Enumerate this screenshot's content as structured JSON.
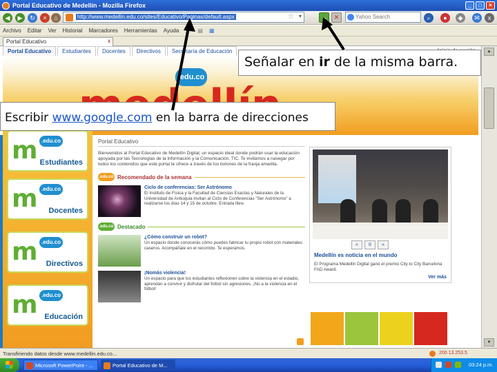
{
  "window": {
    "title": "Portal Educativo de Medellín - Mozilla Firefox",
    "buttons": [
      "_",
      "□",
      "×"
    ]
  },
  "navbar": {
    "back_label": "◀",
    "forward_label": "▶",
    "reload_label": "↻",
    "home_label": "⌂",
    "url": "http://www.medellin.edu.co/sites/Educativo/Paginas/default.aspx",
    "star_label": "☆",
    "url_drop_label": "▾",
    "go_label": "→",
    "stop_label": "✕",
    "search_placeholder": "Yahoo Search"
  },
  "menubar": [
    "Archivo",
    "Editar",
    "Ver",
    "Historial",
    "Marcadores",
    "Herramientas",
    "Ayuda"
  ],
  "browser_tab": {
    "label": "Portal Educativo",
    "close_label": "x"
  },
  "site": {
    "tabs": [
      "Portal Educativo",
      "Estudiantes",
      "Docentes",
      "Directivos",
      "Secretaría de Educación"
    ],
    "login": "Inicio de sesión",
    "brand": "medellín",
    "brand_badge": ".edu.co",
    "profiles": [
      {
        "label": "Estudiantes",
        "badge": ".edu.co",
        "logo": "m"
      },
      {
        "label": "Docentes",
        "badge": ".edu.co",
        "logo": "m"
      },
      {
        "label": "Directivos",
        "badge": ".edu.co",
        "logo": "m"
      },
      {
        "label": "Educación",
        "badge": ".edu.co",
        "logo": "m"
      }
    ],
    "section_title": "Portal Educativo",
    "intro": "Bienvenidos al Portal Educativo de Medellín Digital, un espacio ideal donde podrán usar la educación apoyada por las Tecnologías de la Información y la Comunicación, TIC. Te invitamos a navegar por todos los contenidos que este portal te ofrece a través de los botones de la franja amarilla.",
    "recommended": {
      "badge": ".edu.co",
      "title": "Recomendado de la semana",
      "item_title": "Ciclo de conferencias: Ser Astrónomo",
      "item_desc": "El Instituto de Física y la Facultad de Ciencias Exactas y Naturales de la Universidad de Antioquia invitan al Ciclo de Conferencias \"Ser Astrónomo\" a realizarse los días 14 y 15 de octubre. Entrada libre."
    },
    "featured": {
      "badge": ".edu.co",
      "title": "Destacado",
      "items": [
        {
          "title": "¿Cómo construir un robot?",
          "desc": "Un espacio donde conocerás cómo puedes fabricar tu propio robot con materiales caseros. Acompáñale en el recorrido. Te esperamos."
        },
        {
          "title": "¡Nomás violencia!",
          "desc": "Un espacio para que los estudiantes reflexionen sobre la violencia en el estadio, aprendan a convivir y disfrutar del fútbol sin agresiones. ¡No a la violencia en el fútbol!"
        }
      ]
    },
    "news": {
      "prev_label": "«",
      "pause_label": "II",
      "next_label": "»",
      "title": "Medellín es noticia en el mundo",
      "desc": "El Programa Medellín Digital ganó el premio City to City Barcelona FAD Award.",
      "more": "Ver más"
    },
    "color_blocks": [
      "#f2a71b",
      "#9ac53c",
      "#ecd21e",
      "#d6281f"
    ]
  },
  "status": {
    "text": "Transfiriendo datos desde www.medellin.edu.co...",
    "ip": "200.13.253.5"
  },
  "taskbar": {
    "items": [
      {
        "label": "Microsoft PowerPoint - ...",
        "color": "#d24726"
      },
      {
        "label": "Portal Educativo de M...",
        "color": "#e87a1d"
      }
    ],
    "clock": "03:24 p.m."
  },
  "annotations": {
    "callout_1": {
      "pre": "Señalar en ",
      "bold": "ir",
      "post": " de la misma barra."
    },
    "callout_2": {
      "pre": "Escribir ",
      "link": "www.google.com",
      "post": " en la barra de direcciones"
    }
  }
}
